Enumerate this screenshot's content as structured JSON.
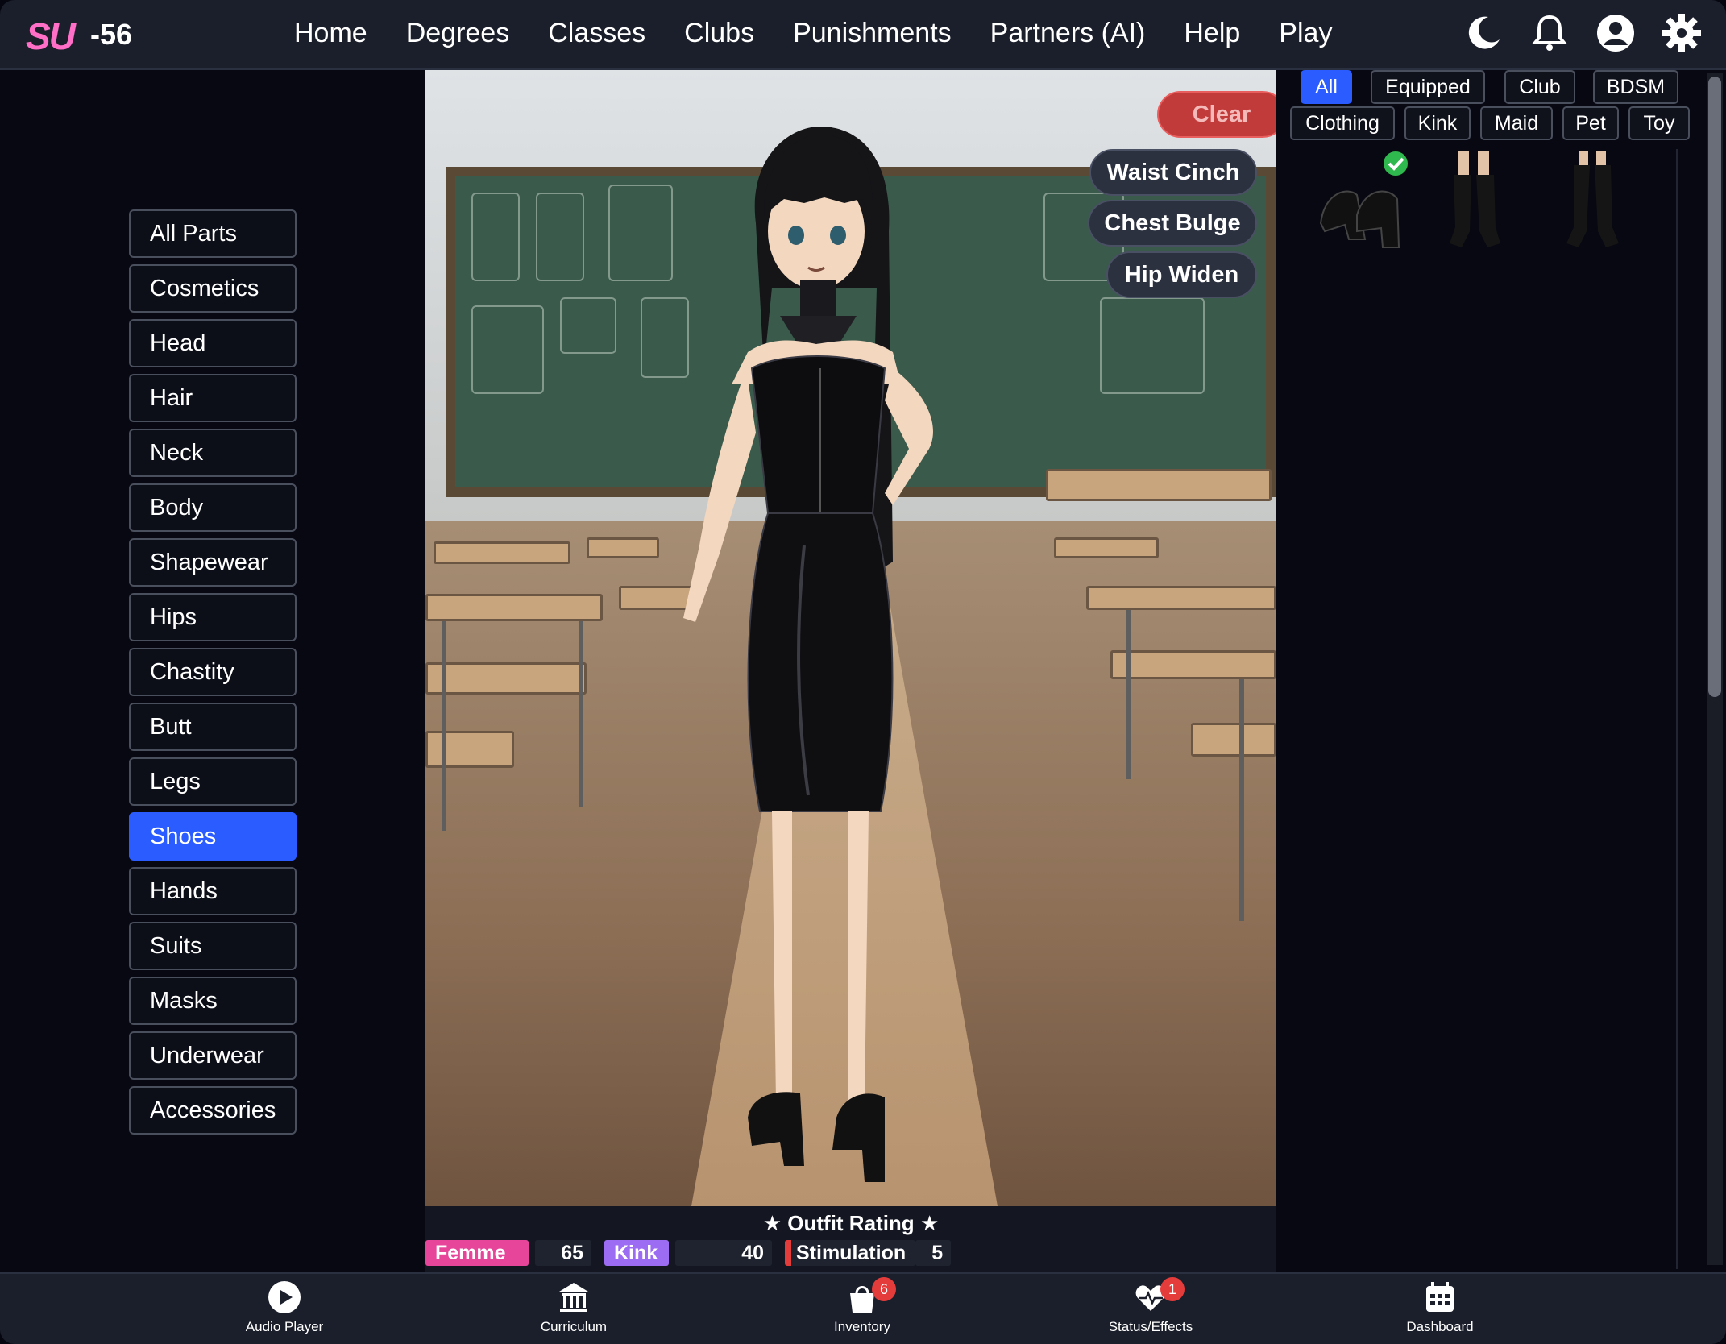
{
  "header": {
    "logo": "SU",
    "score": "-56",
    "nav": [
      "Home",
      "Degrees",
      "Classes",
      "Clubs",
      "Punishments",
      "Partners (AI)",
      "Help",
      "Play"
    ]
  },
  "sidebar": {
    "items": [
      "All Parts",
      "Cosmetics",
      "Head",
      "Hair",
      "Neck",
      "Body",
      "Shapewear",
      "Hips",
      "Chastity",
      "Butt",
      "Legs",
      "Shoes",
      "Hands",
      "Suits",
      "Masks",
      "Underwear",
      "Accessories"
    ],
    "active": "Shoes"
  },
  "stage": {
    "clear_label": "Clear",
    "tags": [
      "Waist Cinch",
      "Chest Bulge",
      "Hip Widen"
    ]
  },
  "rating": {
    "title": "Outfit Rating",
    "stats": [
      {
        "label": "Femme",
        "value": "65",
        "color": "#e6459a"
      },
      {
        "label": "Kink",
        "value": "40",
        "color": "#9c6cf2"
      },
      {
        "label": "Stimulation",
        "value": "5",
        "color": "#e43b3b"
      }
    ]
  },
  "filters": {
    "row1": [
      "All",
      "Equipped",
      "Club",
      "BDSM"
    ],
    "row2": [
      "Clothing",
      "Kink",
      "Maid",
      "Pet",
      "Toy"
    ],
    "active": "All"
  },
  "bottom": {
    "items": [
      {
        "label": "Audio Player",
        "icon": "play-icon"
      },
      {
        "label": "Curriculum",
        "icon": "institution-icon"
      },
      {
        "label": "Inventory",
        "icon": "bag-icon",
        "badge": "6"
      },
      {
        "label": "Status/Effects",
        "icon": "heart-pulse-icon",
        "badge": "1"
      },
      {
        "label": "Dashboard",
        "icon": "calendar-icon"
      }
    ]
  },
  "colors": {
    "accent": "#2a5cff",
    "logo": "#ff6ec7",
    "clear": "#c23b3b"
  }
}
